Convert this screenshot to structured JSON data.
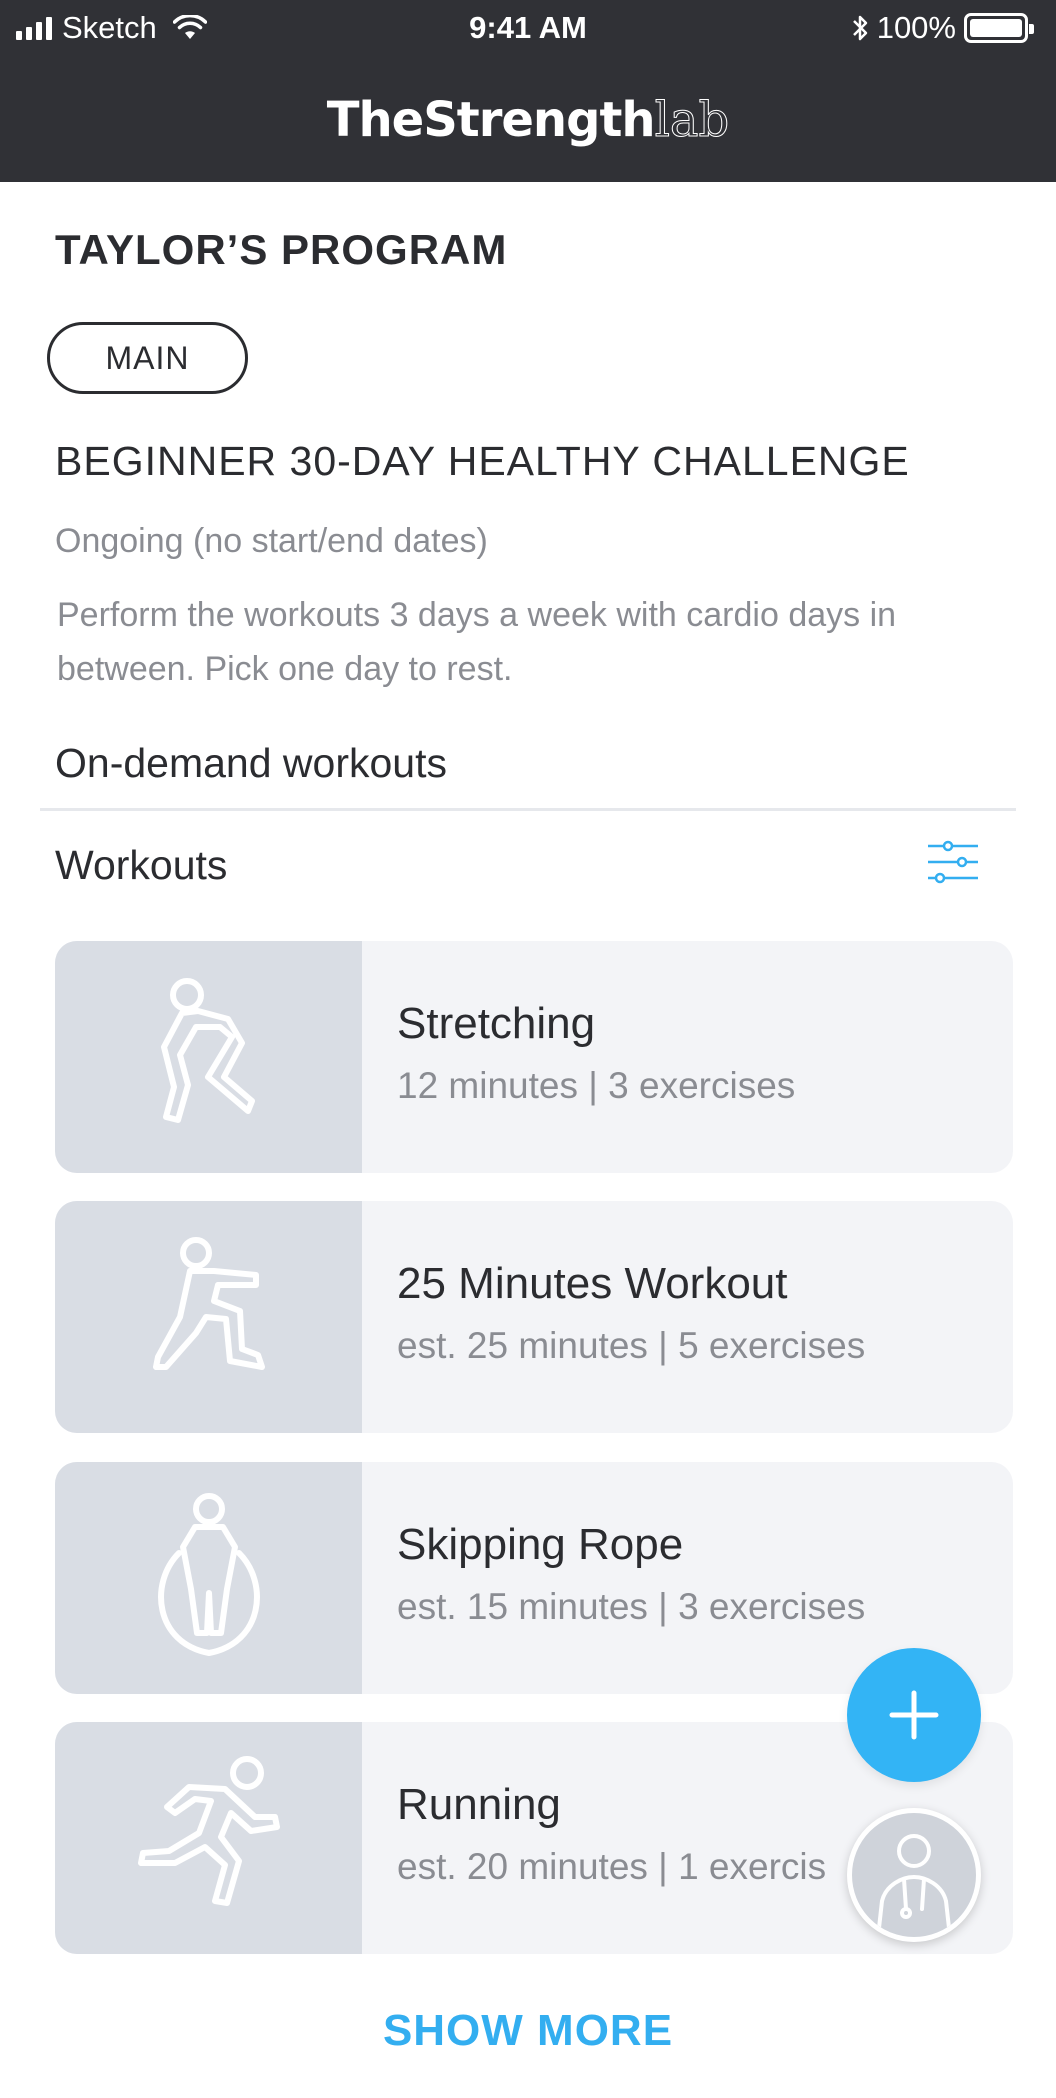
{
  "status_bar": {
    "carrier": "Sketch",
    "time": "9:41 AM",
    "battery": "100%"
  },
  "header": {
    "logo_main": "TheStrength",
    "logo_accent": "lab"
  },
  "program": {
    "title": "TAYLOR’S PROGRAM",
    "tag": "MAIN",
    "challenge_title": "BEGINNER 30-DAY HEALTHY CHALLENGE",
    "dates": "Ongoing (no start/end dates)",
    "description": "Perform the workouts 3 days a week with cardio days in between. Pick one day to rest."
  },
  "section": {
    "heading": "On-demand workouts",
    "subheading": "Workouts"
  },
  "workouts": [
    {
      "name": "Stretching",
      "meta": "12 minutes | 3 exercises",
      "icon": "stretching-figure-icon"
    },
    {
      "name": "25 Minutes Workout",
      "meta": "est. 25 minutes | 5 exercises",
      "icon": "lunge-figure-icon"
    },
    {
      "name": "Skipping Rope",
      "meta": "est. 15 minutes | 3 exercises",
      "icon": "skipping-rope-figure-icon"
    },
    {
      "name": "Running",
      "meta": "est. 20 minutes | 1 exercis",
      "icon": "running-figure-icon"
    }
  ],
  "show_more": "SHOW MORE",
  "colors": {
    "accent": "#33b4f5",
    "header_bg": "#303136",
    "card_bg": "#f3f4f7",
    "thumb_bg": "#d9dde4"
  }
}
